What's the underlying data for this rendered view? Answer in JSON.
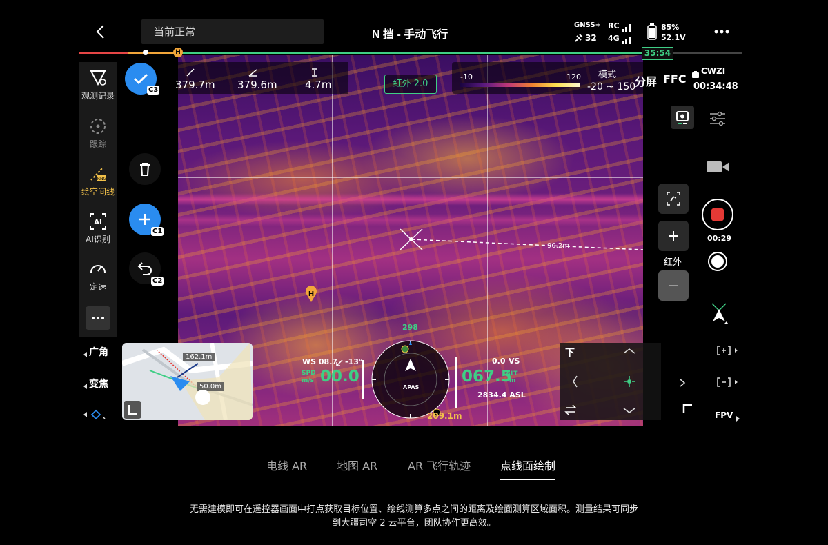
{
  "topbar": {
    "status_text": "当前正常",
    "mode_title": "N 挡 - 手动飞行",
    "gnss_label": "GNSS+",
    "gnss_value": "32",
    "rc_label": "RC",
    "net_label": "4G",
    "battery_percent": "85%",
    "battery_voltage": "52.1V",
    "flight_time_badge": "35:54"
  },
  "progress": {
    "fraction": 0.85
  },
  "left_tools": [
    {
      "label": "观测记录"
    },
    {
      "label": "跟踪"
    },
    {
      "label": "绘空间线"
    },
    {
      "label": "AI识别"
    },
    {
      "label": "定速"
    }
  ],
  "action_buttons": {
    "confirm_chip": "C3",
    "add_chip": "C1",
    "undo_chip": "C2"
  },
  "measurements": {
    "horizontal_distance": "379.7m",
    "slant_distance": "379.6m",
    "height_diff": "4.7m"
  },
  "thermal": {
    "mode_badge": "红外 2.0",
    "palette_min": "-10",
    "palette_max": "120",
    "mode_label": "模式",
    "range": "-20 ~ 150",
    "split_screen": "分屏",
    "ffc": "FFC",
    "cwzi": "CWZI",
    "cwzi_time": "00:34:48"
  },
  "overlay": {
    "line_distance": "90.2m",
    "home_marker": "H"
  },
  "right_panel": {
    "zoom_label": "红外",
    "record_time": "00:29",
    "fpv_label": "FPV"
  },
  "lens_menu": {
    "wide": "广角",
    "zoom": "变焦"
  },
  "minimap": {
    "dist1": "162.1m",
    "dist2": "50.0m"
  },
  "telemetry": {
    "ws": "WS 08.7",
    "ws_angle": "-13°",
    "spd_label1": "SPD",
    "spd_label2": "m/s",
    "speed": "00.0",
    "compass_top": "298",
    "compass_center": "APAS",
    "home_distance": "209.1m",
    "vs_value": "0.0",
    "vs_label": "VS",
    "alt_value": "067.5",
    "alt_label1": "ALT",
    "alt_label2": "m",
    "asl": "2834.4 ASL"
  },
  "nav": {
    "down_label": "下"
  },
  "tabs": [
    {
      "label": "电线 AR"
    },
    {
      "label": "地图 AR"
    },
    {
      "label": "AR 飞行轨迹"
    },
    {
      "label": "点线面绘制"
    }
  ],
  "description": {
    "line1": "无需建模即可在遥控器画面中打点获取目标位置、绘线测算多点之间的距离及绘面测算区域面积。测量结果可同步",
    "line2": "到大疆司空 2 云平台，团队协作更高效。"
  },
  "colors": {
    "accent_green": "#3fce85",
    "accent_blue": "#2a8cf0",
    "record_red": "#e53935"
  }
}
